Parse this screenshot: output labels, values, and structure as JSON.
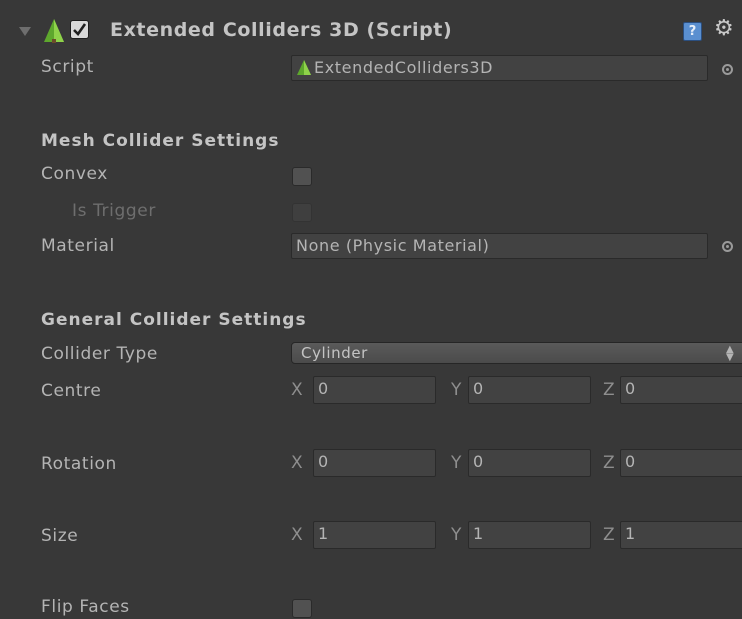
{
  "header": {
    "title": "Extended Colliders 3D (Script)",
    "enabled": true,
    "icons": [
      "fold-arrow-icon",
      "tree-icon",
      "checkbox-icon",
      "help-icon",
      "gear-icon"
    ]
  },
  "script": {
    "label": "Script",
    "value": "ExtendedColliders3D"
  },
  "mesh_section": {
    "title": "Mesh Collider Settings",
    "convex_label": "Convex",
    "convex_checked": false,
    "is_trigger_label": "Is Trigger",
    "is_trigger_checked": false,
    "material_label": "Material",
    "material_value": "None (Physic Material)"
  },
  "general_section": {
    "title": "General Collider Settings",
    "collider_type_label": "Collider Type",
    "collider_type_value": "Cylinder",
    "centre": {
      "label": "Centre",
      "x": "0",
      "y": "0",
      "z": "0"
    },
    "rotation": {
      "label": "Rotation",
      "x": "0",
      "y": "0",
      "z": "0"
    },
    "size": {
      "label": "Size",
      "x": "1",
      "y": "1",
      "z": "1"
    },
    "flip_faces_label": "Flip Faces",
    "flip_faces_checked": false
  },
  "axis_labels": {
    "x": "X",
    "y": "Y",
    "z": "Z"
  },
  "colors": {
    "background": "#383838",
    "field": "#424242",
    "text": "#b4b4b4",
    "disabled_text": "#6e6e6e",
    "accent_green": "#79b53c"
  }
}
